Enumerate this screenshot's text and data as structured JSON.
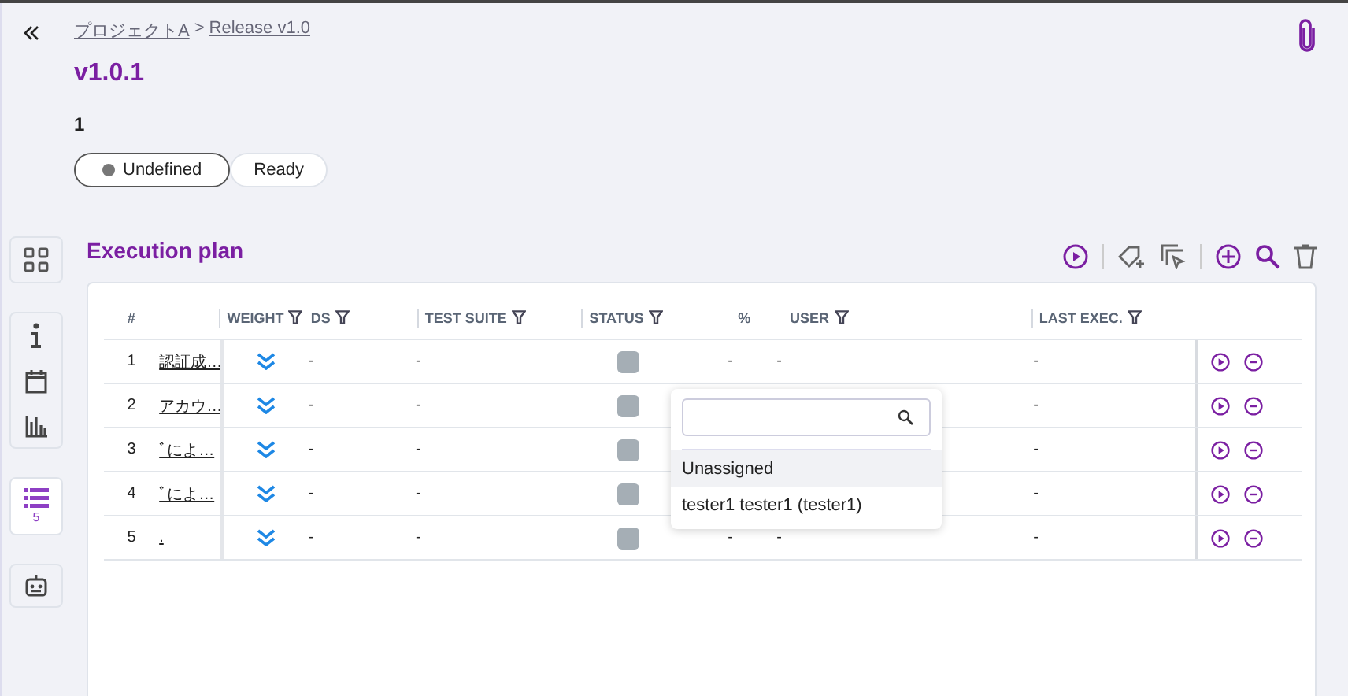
{
  "breadcrumb": {
    "items": [
      {
        "label": "プロジェクトA"
      },
      {
        "label": "Release v1.0"
      }
    ],
    "separator": ">"
  },
  "title": "v1.0.1",
  "count": "1",
  "statuses": [
    {
      "label": "Undefined",
      "selected": true,
      "dot": true
    },
    {
      "label": "Ready",
      "selected": false,
      "dot": false
    }
  ],
  "side_nav": [
    {
      "group": [
        {
          "kind": "grid"
        }
      ],
      "selected": false
    },
    {
      "group": [
        {
          "kind": "info"
        },
        {
          "kind": "calendar"
        },
        {
          "kind": "chart"
        }
      ],
      "selected": false
    },
    {
      "group": [
        {
          "kind": "list",
          "badge": "5"
        }
      ],
      "selected": true
    },
    {
      "group": [
        {
          "kind": "robot"
        }
      ],
      "selected": false
    }
  ],
  "section_title": "Execution plan",
  "table": {
    "columns": [
      {
        "label": "#",
        "filter": false
      },
      {
        "label": "WEIGHT",
        "filter": true
      },
      {
        "label": "DS",
        "filter": true
      },
      {
        "label": "TEST SUITE",
        "filter": true
      },
      {
        "label": "STATUS",
        "filter": true
      },
      {
        "label": "%",
        "filter": false
      },
      {
        "label": "USER",
        "filter": true
      },
      {
        "label": "LAST EXEC.",
        "filter": true
      }
    ],
    "rows": [
      {
        "index": "1",
        "name": "認証成…",
        "ds": "-",
        "suite": "-",
        "percent": "-",
        "user": "-",
        "last": "-"
      },
      {
        "index": "2",
        "name": "アカウ…",
        "ds": "-",
        "suite": "-",
        "last": "-"
      },
      {
        "index": "3",
        "name": "ﾞによ…",
        "ds": "-",
        "suite": "-",
        "last": "-"
      },
      {
        "index": "4",
        "name": "ﾞによ…",
        "ds": "-",
        "suite": "-",
        "last": "-"
      },
      {
        "index": "5",
        "name": ".",
        "ds": "-",
        "suite": "-",
        "percent": "-",
        "user": "-",
        "last": "-"
      }
    ]
  },
  "user_dropdown": {
    "options": [
      {
        "label": "Unassigned",
        "selected": true
      },
      {
        "label": "tester1 tester1 (tester1)",
        "selected": false
      }
    ]
  }
}
